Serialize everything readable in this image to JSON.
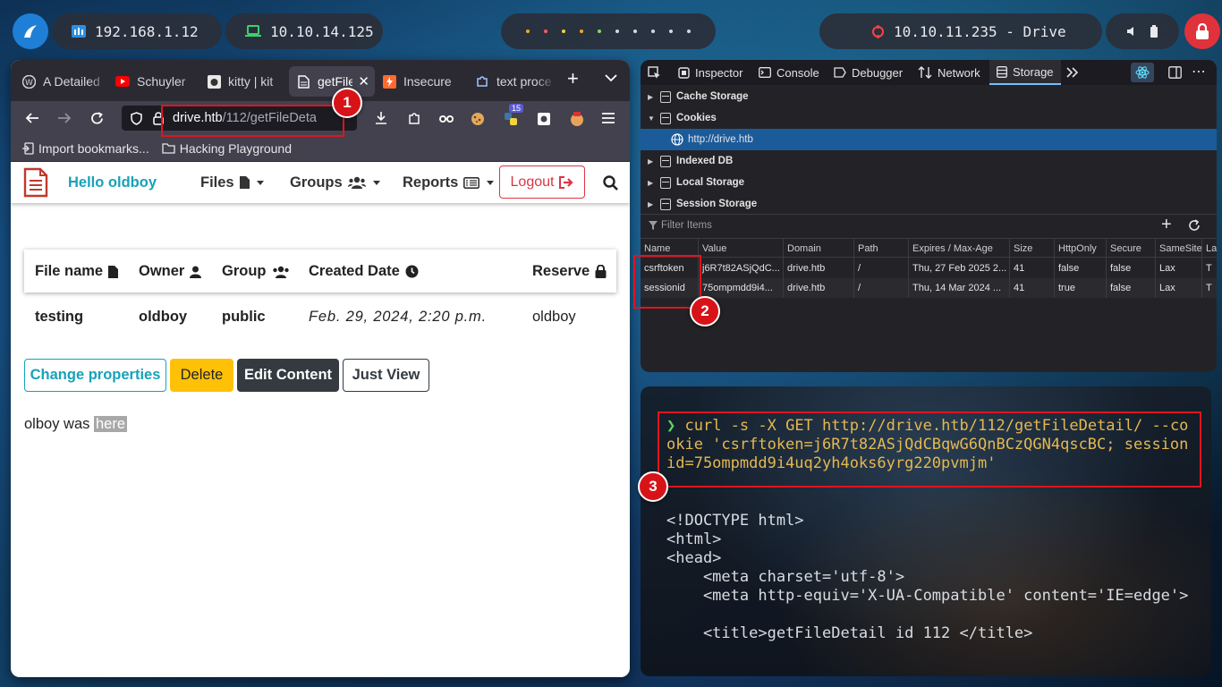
{
  "panel": {
    "ips": [
      "192.168.1.12",
      "10.10.14.125"
    ],
    "target": "10.10.11.235 - Drive",
    "dot_colors": [
      "#f5a623",
      "#ff5a5a",
      "#f5d33a",
      "#f5a623",
      "#8ad36a",
      "#d8d8d8",
      "#d8d8d8",
      "#d8d8d8",
      "#d8d8d8",
      "#d8d8d8"
    ],
    "accent_red": "#e0323a"
  },
  "browser": {
    "tabs": [
      {
        "label": "A Detailed",
        "icon": "wordpress-icon"
      },
      {
        "label": "Schuyler",
        "icon": "youtube-icon"
      },
      {
        "label": "kitty | kit",
        "icon": "kitty-icon"
      },
      {
        "label": "getFile",
        "icon": "document-icon",
        "active": true
      },
      {
        "label": "Insecure",
        "icon": "bolt-icon"
      },
      {
        "label": "text proce",
        "icon": "puzzle-icon"
      }
    ],
    "url_host": "drive.htb",
    "url_path": "/112/getFileDeta",
    "extension_badge": "15",
    "bookmarks": [
      "Import bookmarks...",
      "Hacking Playground"
    ]
  },
  "site": {
    "brand": "Hello oldboy",
    "menus": [
      "Files",
      "Groups",
      "Reports"
    ],
    "logout": "Logout",
    "table_headers": [
      "File name",
      "Owner",
      "Group",
      "Created Date",
      "Reserve"
    ],
    "row": {
      "file_name": "testing",
      "owner": "oldboy",
      "group": "public",
      "created": "Feb. 29, 2024, 2:20 p.m.",
      "reserve": "oldboy"
    },
    "buttons": {
      "change": "Change properties",
      "delete": "Delete",
      "edit": "Edit Content",
      "view": "Just View"
    },
    "footer_text": "olboy was ",
    "footer_link": "here"
  },
  "devtools": {
    "tabs": [
      "Inspector",
      "Console",
      "Debugger",
      "Network",
      "Storage"
    ],
    "tree": [
      {
        "label": "Cache Storage",
        "expanded": false
      },
      {
        "label": "Cookies",
        "expanded": true
      },
      {
        "label": "http://drive.htb",
        "child": true,
        "selected": true
      },
      {
        "label": "Indexed DB",
        "expanded": false
      },
      {
        "label": "Local Storage",
        "expanded": false
      },
      {
        "label": "Session Storage",
        "expanded": false
      }
    ],
    "filter_placeholder": "Filter Items",
    "columns": [
      "Name",
      "Value",
      "Domain",
      "Path",
      "Expires / Max-Age",
      "Size",
      "HttpOnly",
      "Secure",
      "SameSite",
      "La"
    ],
    "cookies": [
      {
        "name": "csrftoken",
        "value": "j6R7t82ASjQdC...",
        "domain": "drive.htb",
        "path": "/",
        "expires": "Thu, 27 Feb 2025 2...",
        "size": "41",
        "httponly": "false",
        "secure": "false",
        "samesite": "Lax",
        "last": "T"
      },
      {
        "name": "sessionid",
        "value": "75ompmdd9i4...",
        "domain": "drive.htb",
        "path": "/",
        "expires": "Thu, 14 Mar 2024 ...",
        "size": "41",
        "httponly": "true",
        "secure": "false",
        "samesite": "Lax",
        "last": "T"
      }
    ]
  },
  "terminal": {
    "prompt": "❯",
    "command": "curl -s -X GET http://drive.htb/112/getFileDetail/ --cookie 'csrftoken=j6R7t82ASjQdCBqwG6QnBCzQGN4qscBC; sessionid=75ompmdd9i4uq2yh4oks6yrg220pvmjm'",
    "output": [
      "<!DOCTYPE html>",
      "<html>",
      "<head>",
      "    <meta charset='utf-8'>",
      "    <meta http-equiv='X-UA-Compatible' content='IE=edge'>",
      "",
      "    <title>getFileDetail id 112 </title>"
    ]
  },
  "annotations": {
    "one": "1",
    "two": "2",
    "three": "3"
  }
}
